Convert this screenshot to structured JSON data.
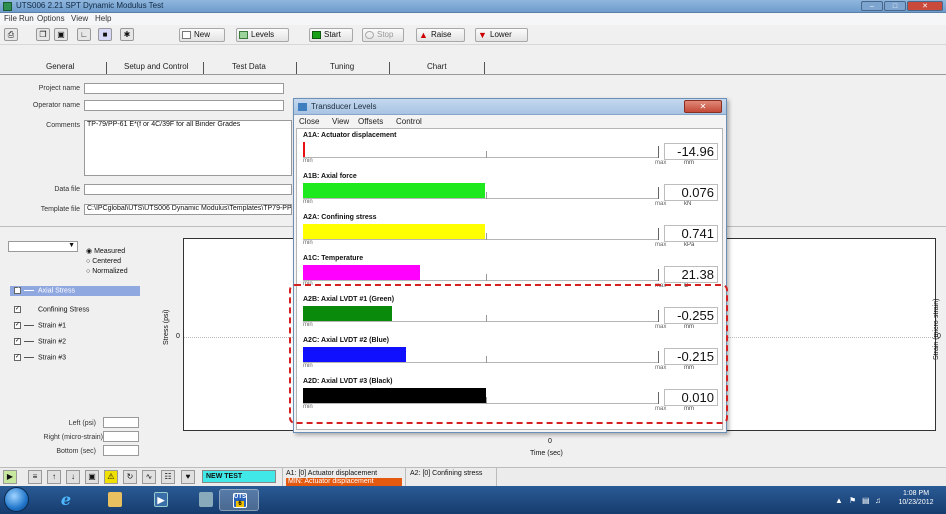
{
  "window": {
    "title": "UTS006 2.21 SPT Dynamic Modulus Test"
  },
  "menu": [
    "File",
    "Run",
    "Options",
    "View",
    "Help"
  ],
  "toolbar": {
    "new_label": "New",
    "levels_label": "Levels",
    "start_label": "Start",
    "stop_label": "Stop",
    "raise_label": "Raise",
    "lower_label": "Lower"
  },
  "tabs": [
    "General",
    "Setup and Control",
    "Test Data",
    "Tuning",
    "Chart"
  ],
  "general": {
    "project_label": "Project name",
    "project_value": "",
    "operator_label": "Operator name",
    "operator_value": "",
    "comments_label": "Comments",
    "comments_value": "TP-79/PP-61 E*(f or 4C/39F for all Binder Grades",
    "datafile_label": "Data file",
    "datafile_value": "",
    "template_label": "Template file",
    "template_value": "C:\\IPCglobal\\UTS\\UTS006 Dynamic Modulus\\Templates\\TP79-PP"
  },
  "chart_panel": {
    "mode_options": [
      "Measured",
      "Centered",
      "Normalized"
    ],
    "selected_mode": "Measured",
    "legend": [
      {
        "label": "Axial Stress",
        "checked": true,
        "selected": true
      },
      {
        "label": "Confining Stress",
        "checked": true,
        "selected": false
      },
      {
        "label": "Strain #1",
        "checked": true,
        "selected": false
      },
      {
        "label": "Strain #2",
        "checked": true,
        "selected": false
      },
      {
        "label": "Strain #3",
        "checked": true,
        "selected": false
      }
    ],
    "left_label": "Left (psi)",
    "right_label": "Right (micro-strain)",
    "bottom_label": "Bottom (sec)",
    "y_left_axis": "Stress (psi)",
    "y_right_axis": "Strain (micro-strain)",
    "x_axis": "Time (sec)",
    "y_left_tick": "0",
    "y_right_tick": "0",
    "x_tick": "0"
  },
  "dialog": {
    "title": "Transducer Levels",
    "menu": [
      "Close",
      "View",
      "Offsets",
      "Control"
    ],
    "min_label": "min",
    "max_label": "max",
    "channels": [
      {
        "name": "A1A:  Actuator displacement",
        "value": "-14.96",
        "unit": "mm",
        "color": "#e81010",
        "level": 0.005
      },
      {
        "name": "A1B:  Axial force",
        "value": "0.076",
        "unit": "kN",
        "color": "#1ee81e",
        "level": 0.51
      },
      {
        "name": "A2A:  Confining stress",
        "value": "0.741",
        "unit": "kPa",
        "color": "#ffff00",
        "level": 0.51
      },
      {
        "name": "A1C:  Temperature",
        "value": "21.38",
        "unit": "C",
        "color": "#ff00ff",
        "level": 0.33
      },
      {
        "name": "A2B:  Axial LVDT #1 (Green)",
        "value": "-0.255",
        "unit": "mm",
        "color": "#0a8a0a",
        "level": 0.25
      },
      {
        "name": "A2C:  Axial LVDT #2 (Blue)",
        "value": "-0.215",
        "unit": "mm",
        "color": "#1010ff",
        "level": 0.29
      },
      {
        "name": "A2D:  Axial LVDT #3 (Black)",
        "value": "0.010",
        "unit": "mm",
        "color": "#000000",
        "level": 0.515
      }
    ]
  },
  "statusbar": {
    "new_test": "NEW TEST",
    "status_a": "A1: [0] Actuator displacement",
    "status_min": "MIN: Actuator displacement",
    "status_b": "A2: [0] Confining stress"
  },
  "taskbar": {
    "uts_badge": "6",
    "time": "1:08 PM",
    "date": "10/23/2012"
  }
}
